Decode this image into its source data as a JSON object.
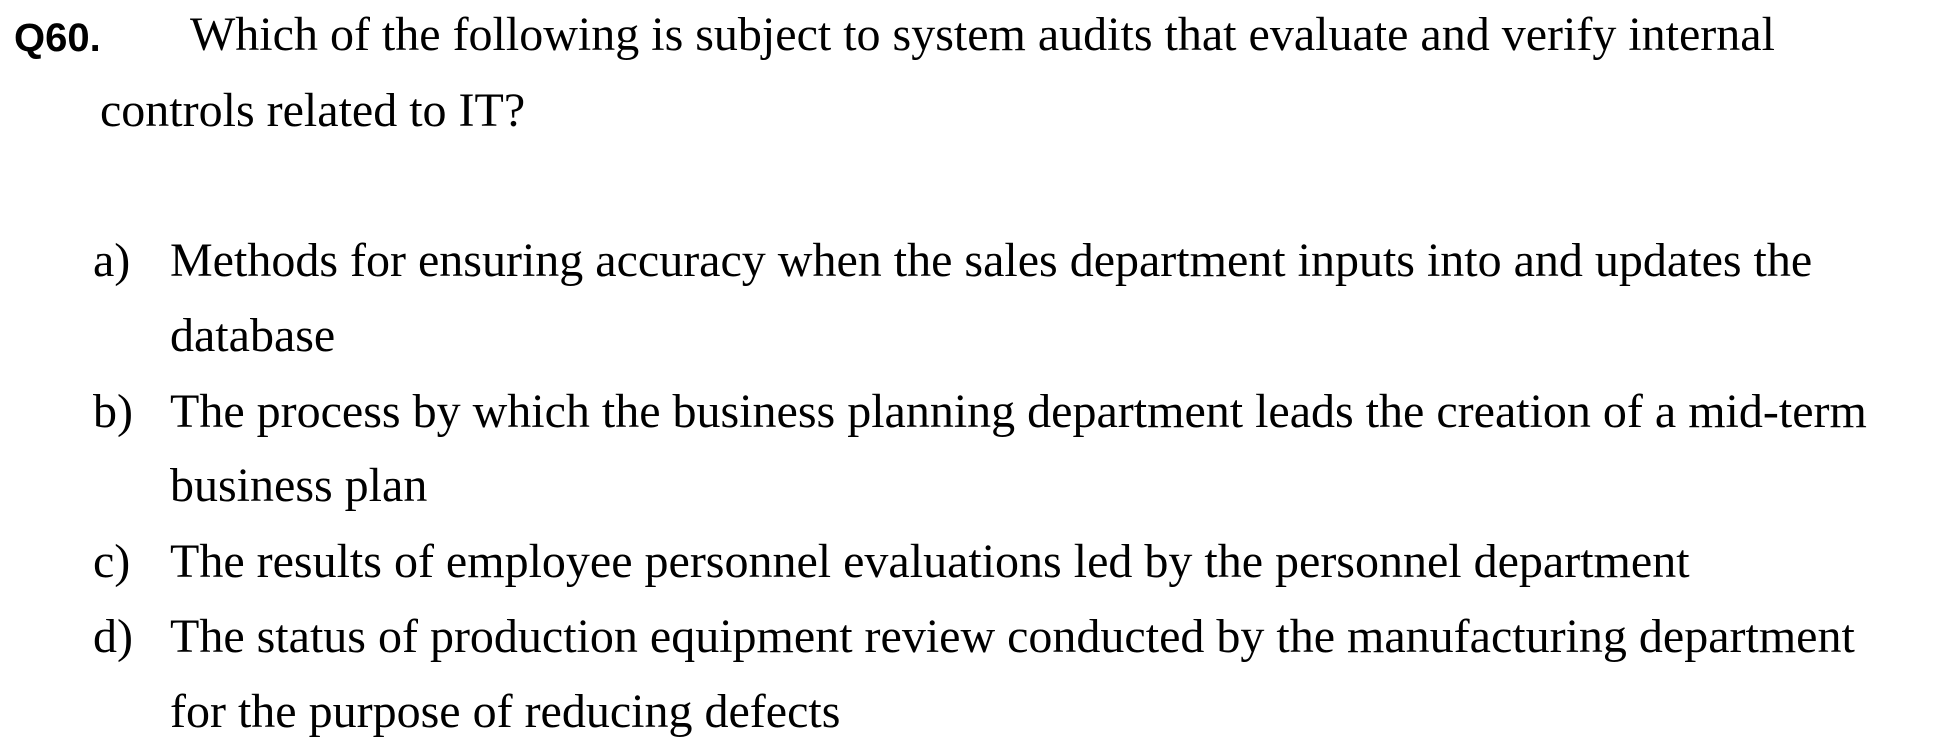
{
  "question": {
    "number": "Q60.",
    "line1": "Which of the following is subject to system audits that evaluate and verify internal",
    "line2": "controls related to IT?"
  },
  "options": [
    {
      "letter": "a)",
      "lines": [
        "Methods for ensuring accuracy when the sales department inputs into and updates the",
        "database"
      ]
    },
    {
      "letter": "b)",
      "lines": [
        "The process by which the business planning department leads the creation of a mid-term",
        "business plan"
      ]
    },
    {
      "letter": "c)",
      "lines": [
        "The results of employee personnel evaluations led by the personnel department"
      ]
    },
    {
      "letter": "d)",
      "lines": [
        "The status of production equipment review conducted by the manufacturing department",
        "for the purpose of reducing defects"
      ]
    }
  ]
}
